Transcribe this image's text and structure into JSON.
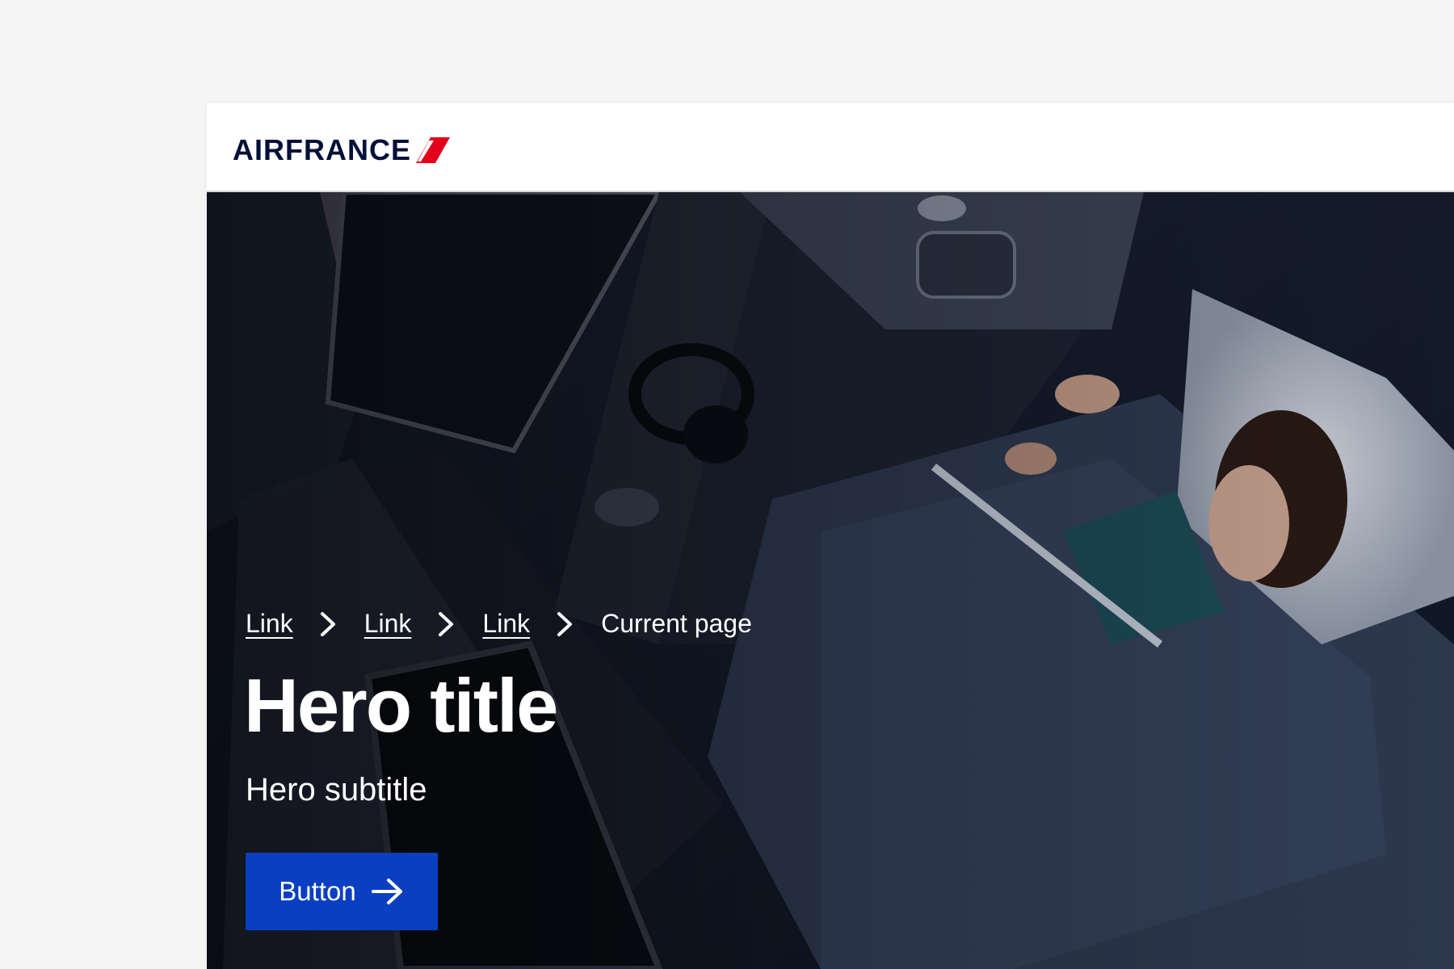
{
  "header": {
    "logo_text": "AIRFRANCE",
    "brand_color": "#051039",
    "accent_color": "#e3001b"
  },
  "hero": {
    "breadcrumb": [
      {
        "label": "Link"
      },
      {
        "label": "Link"
      },
      {
        "label": "Link"
      }
    ],
    "current_page": "Current page",
    "title": "Hero title",
    "subtitle": "Hero subtitle",
    "button_label": "Button",
    "button_color": "#0a3fc2",
    "icons": {
      "separator": "chevron-right-icon",
      "button": "arrow-right-icon"
    }
  }
}
